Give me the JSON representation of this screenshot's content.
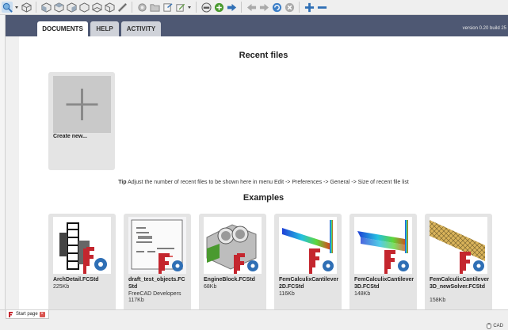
{
  "header": {
    "tabs": [
      {
        "label": "DOCUMENTS",
        "active": true
      },
      {
        "label": "HELP",
        "active": false
      },
      {
        "label": "ACTIVITY",
        "active": false
      }
    ],
    "version": "version 0.20 build 25"
  },
  "recent": {
    "title": "Recent files",
    "create_label": "Create new..."
  },
  "tip": {
    "label": "Tip",
    "text": "Adjust the number of recent files to be shown here in menu Edit -> Preferences -> General -> Size of recent file list"
  },
  "examples": {
    "title": "Examples",
    "items": [
      {
        "name": "ArchDetail.FCStd",
        "author": "",
        "size": "225Kb"
      },
      {
        "name": "draft_test_objects.FCStd",
        "author": "FreeCAD Developers",
        "size": "117Kb"
      },
      {
        "name": "EngineBlock.FCStd",
        "author": "",
        "size": "68Kb"
      },
      {
        "name": "FemCalculixCantilever2D.FCStd",
        "author": "",
        "size": "116Kb"
      },
      {
        "name": "FemCalculixCantilever3D.FCStd",
        "author": "",
        "size": "148Kb"
      },
      {
        "name": "FemCalculixCantilever3D_newSolver.FCStd",
        "author": "",
        "size": "158Kb"
      }
    ]
  },
  "statusbar": {
    "page_tab": "Start page",
    "nav_style": "CAD"
  },
  "colors": {
    "header_bg": "#4e5873",
    "freecad_red": "#c4262e",
    "accent_blue": "#2f6fb5"
  },
  "icons": [
    "zoom-icon",
    "view-iso-icon",
    "view-front-icon",
    "view-top-icon",
    "view-right-icon",
    "view-rear-icon",
    "view-bottom-icon",
    "view-left-icon",
    "measure-icon",
    "part-icon",
    "folder-icon",
    "export-icon",
    "macro-edit-icon",
    "stop-icon",
    "record-icon",
    "forward-icon",
    "back-arrow-icon",
    "forward-arrow-icon",
    "refresh-icon",
    "stop-load-icon",
    "zoom-in-icon",
    "zoom-out-icon"
  ]
}
